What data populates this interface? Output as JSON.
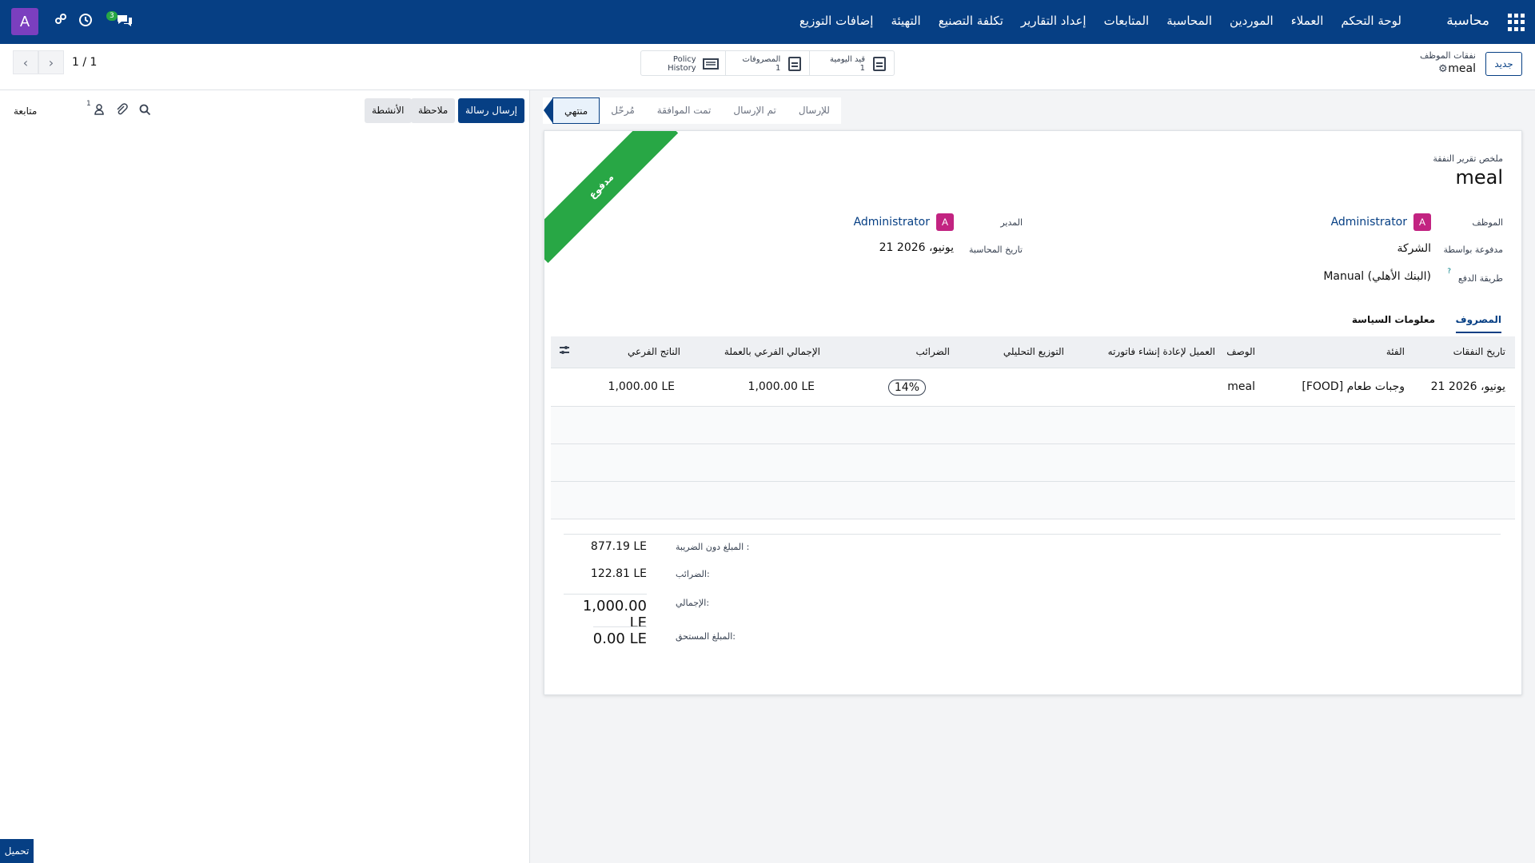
{
  "topbar": {
    "brand": "محاسبة",
    "menu": [
      "لوحة التحكم",
      "العملاء",
      "الموردين",
      "المحاسبة",
      "المتابعات",
      "إعداد التقارير",
      "تكلفة التصنيع",
      "التهيئة",
      "إضافات التوزيع"
    ],
    "avatar_letter": "A",
    "chat_badge": "3"
  },
  "control_panel": {
    "new_button": "جديد",
    "breadcrumb_parent": "نفقات الموظف",
    "breadcrumb_current": "meal",
    "pager": "1 / 1",
    "smart_buttons": [
      {
        "label": "قيد اليومية",
        "count": "1"
      },
      {
        "label": "المصروفات",
        "count": "1"
      },
      {
        "label": "Policy",
        "count": "History"
      }
    ]
  },
  "statusbar": [
    "للإرسال",
    "تم الإرسال",
    "تمت الموافقة",
    "مُرحّل",
    "منتهي"
  ],
  "status_active_index": 4,
  "form": {
    "ribbon": "مدفوع",
    "summary_label": "ملخص تقرير النفقة",
    "title": "meal",
    "employee_label": "الموظف",
    "employee": "Administrator",
    "paid_by_label": "مدفوعة بواسطة",
    "paid_by": "الشركة",
    "payment_method_label": "طريقة الدفع",
    "payment_method": "Manual (البنك الأهلي)",
    "manager_label": "المدير",
    "manager": "Administrator",
    "accounting_date_label": "تاريخ المحاسبة",
    "accounting_date": "21 يونيو، 2026",
    "avatar_letter": "A"
  },
  "tabs": [
    "المصروف",
    "معلومات السياسة"
  ],
  "table": {
    "headers": [
      "تاريخ النفقات",
      "الفئة",
      "الوصف",
      "العميل لإعادة إنشاء فاتورته",
      "التوزيع التحليلي",
      "الضرائب",
      "الإجمالي الفرعي بالعملة",
      "الناتج الفرعي"
    ],
    "row": {
      "date": "21 يونيو، 2026",
      "category": "[FOOD] وجبات طعام",
      "description": "meal",
      "tax": "14%",
      "subtotal_currency": "1,000.00 LE",
      "subtotal": "1,000.00 LE"
    }
  },
  "totals": [
    {
      "label": "المبلغ دون الضريبة :",
      "value": "877.19 LE"
    },
    {
      "label": "الضرائب:",
      "value": "122.81 LE"
    },
    {
      "label": "الإجمالي:",
      "value": "1,000.00 LE"
    },
    {
      "label": "المبلغ المستحق:",
      "value": "0.00 LE"
    }
  ],
  "chatter": {
    "send": "إرسال رسالة",
    "note": "ملاحظة",
    "activities": "الأنشطة",
    "follow": "متابعة",
    "followers": "1",
    "upload": "تحميل"
  }
}
